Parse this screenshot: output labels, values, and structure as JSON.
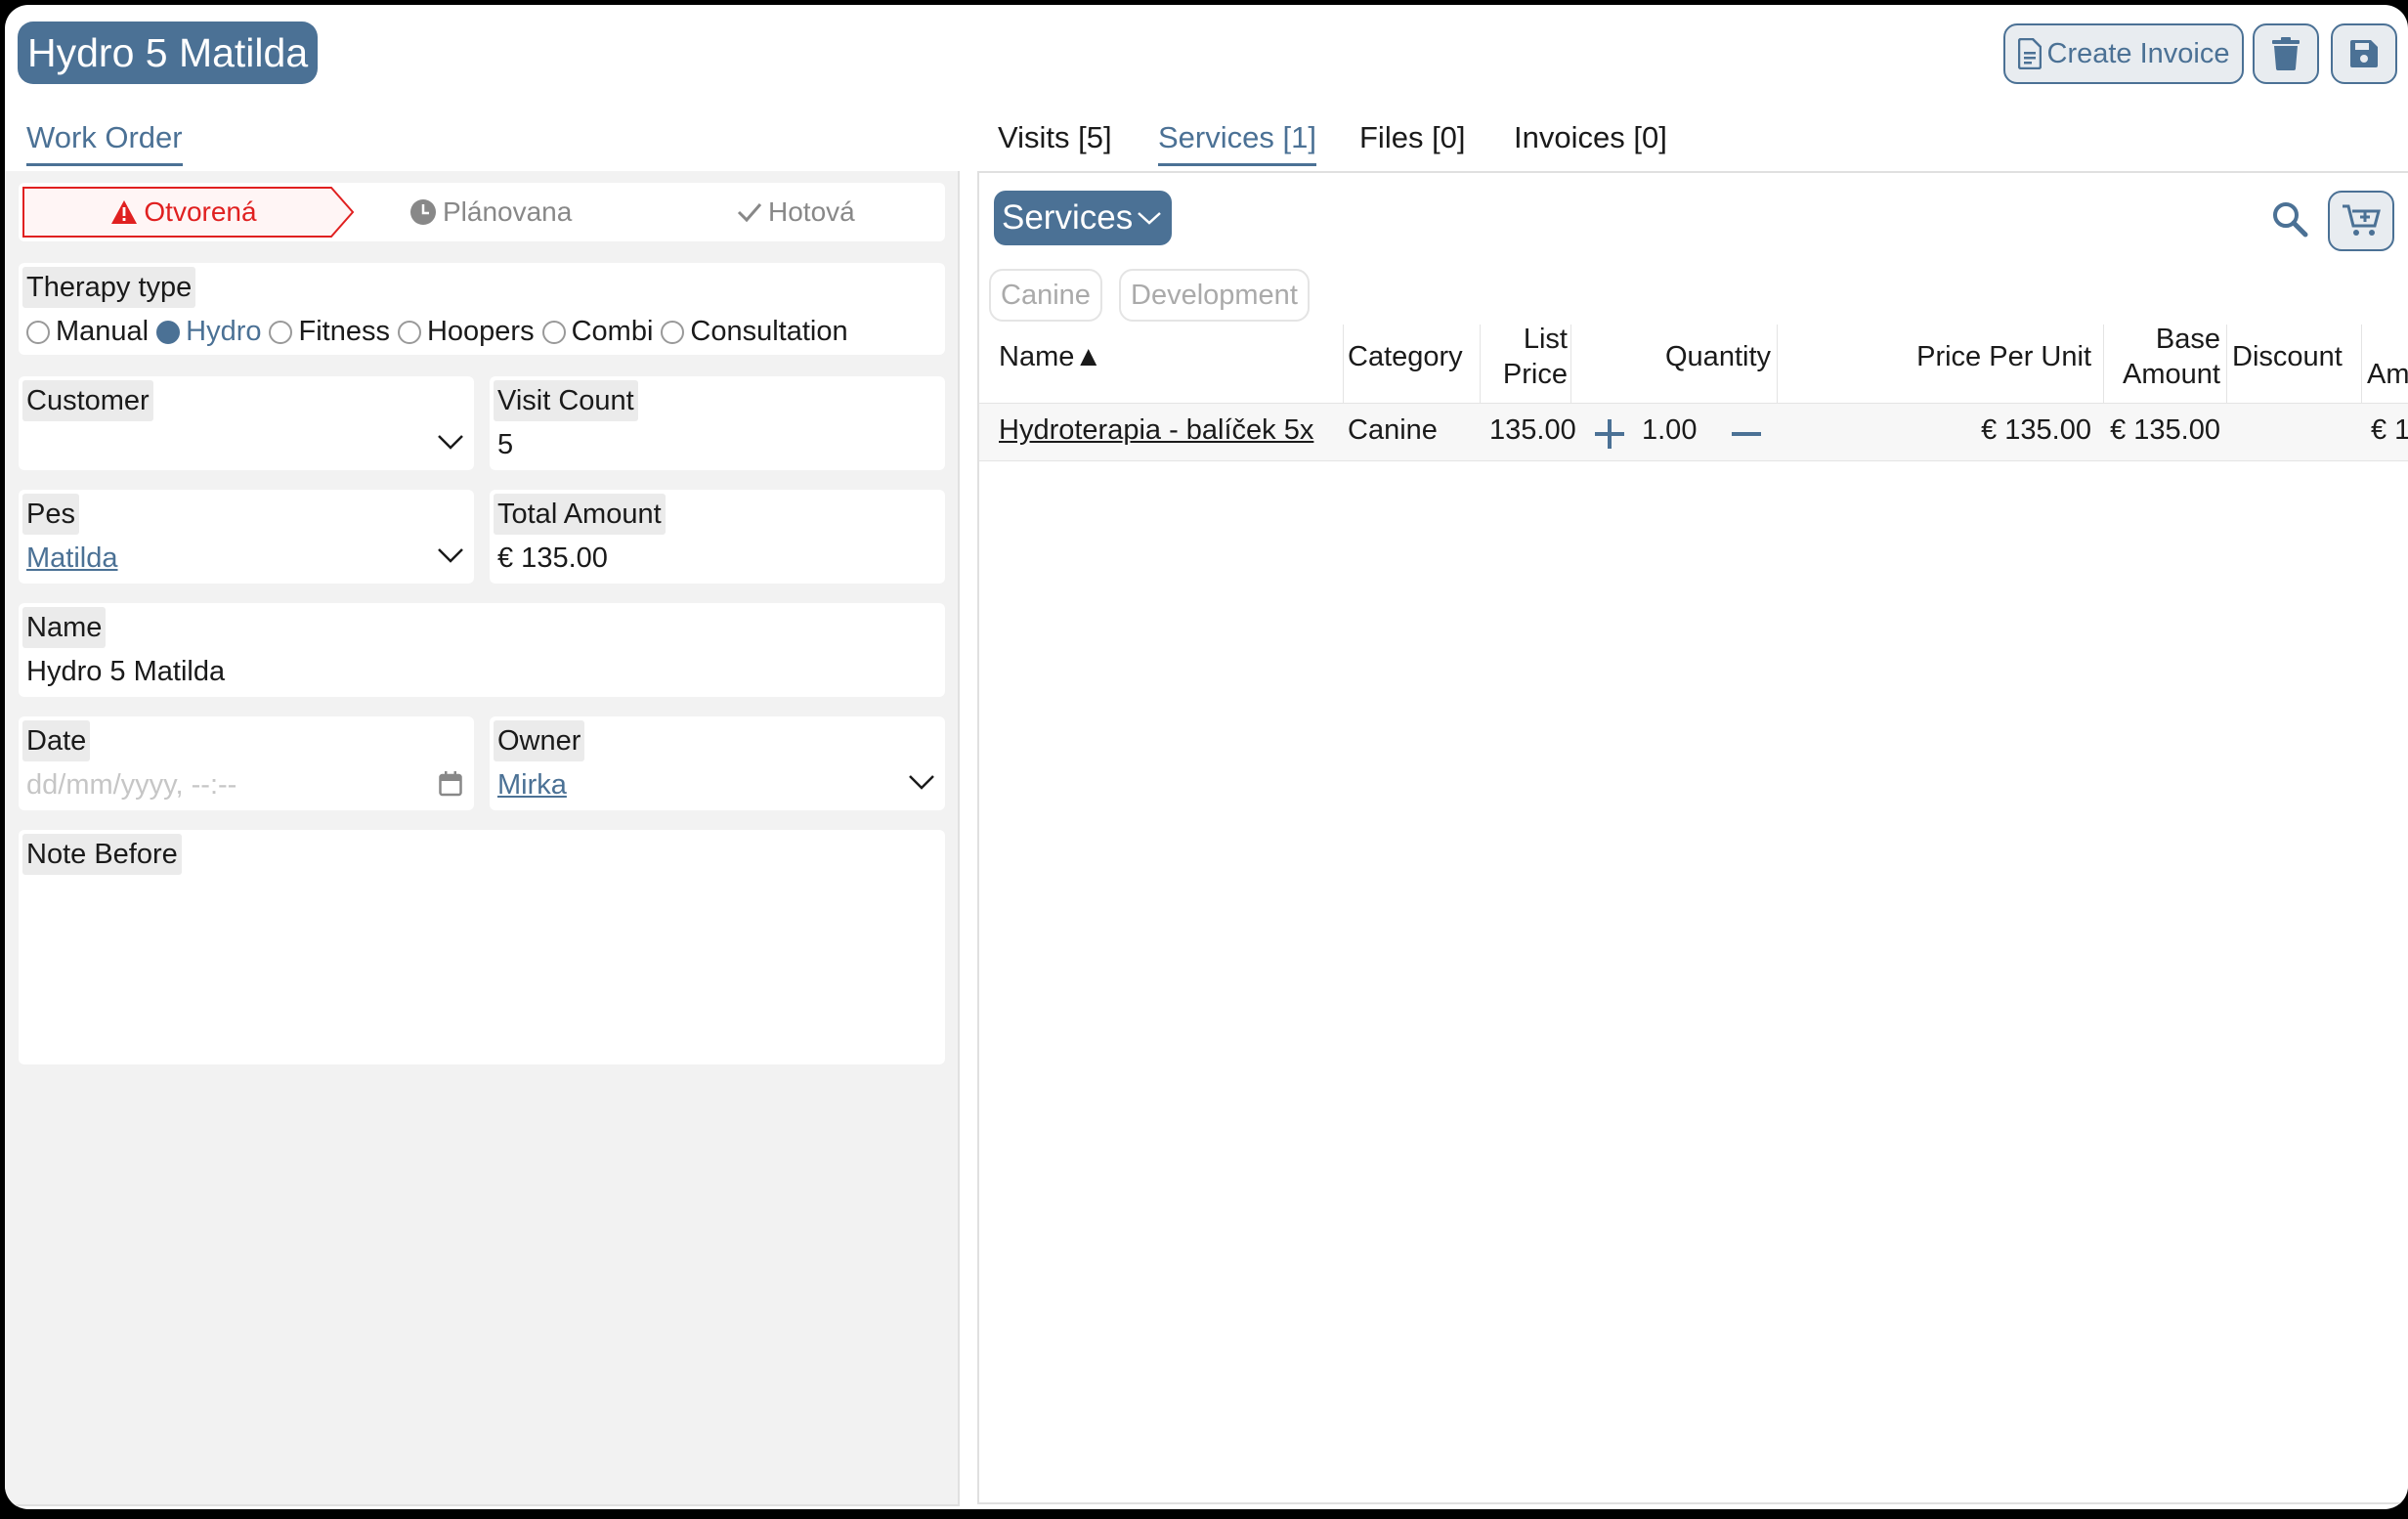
{
  "header": {
    "title": "Hydro 5 Matilda",
    "create_invoice_label": "Create Invoice",
    "delete_icon": "trash-icon",
    "save_icon": "floppy-disk-icon",
    "accent_color": "#4b7195"
  },
  "left": {
    "tab_label": "Work Order",
    "status": {
      "open": "Otvorená",
      "planned": "Plánovana",
      "done": "Hotová",
      "open_color": "#e02020"
    },
    "therapy": {
      "label": "Therapy type",
      "options": [
        "Manual",
        "Hydro",
        "Fitness",
        "Hoopers",
        "Combi",
        "Consultation"
      ],
      "selected": "Hydro"
    },
    "customer": {
      "label": "Customer",
      "value": ""
    },
    "visit_count": {
      "label": "Visit Count",
      "value": "5"
    },
    "pes": {
      "label": "Pes",
      "value": "Matilda"
    },
    "total_amount": {
      "label": "Total Amount",
      "value": "€ 135.00"
    },
    "name": {
      "label": "Name",
      "value": "Hydro 5 Matilda"
    },
    "date": {
      "label": "Date",
      "placeholder": "dd/mm/yyyy, --:--"
    },
    "owner": {
      "label": "Owner",
      "value": "Mirka"
    },
    "note_before": {
      "label": "Note Before",
      "value": ""
    }
  },
  "right": {
    "tabs": [
      "Visits [5]",
      "Services [1]",
      "Files [0]",
      "Invoices [0]"
    ],
    "active_tab": "Services [1]",
    "services_dropdown": "Services",
    "chips": [
      "Canine",
      "Development"
    ],
    "columns": {
      "name": "Name",
      "sort_indicator": "▲",
      "category": "Category",
      "list_price_1": "List",
      "list_price_2": "Price",
      "quantity": "Quantity",
      "price_per_unit": "Price Per Unit",
      "base_amount_1": "Base",
      "base_amount_2": "Amount",
      "discount": "Discount",
      "amount_partial": "Am"
    },
    "rows": [
      {
        "name": "Hydroterapia - balíček 5x",
        "category": "Canine",
        "list_price": "135.00",
        "quantity": "1.00",
        "price_per_unit": "€ 135.00",
        "base_amount": "€ 135.00",
        "discount": "",
        "amount_partial": "€ 1"
      }
    ]
  }
}
